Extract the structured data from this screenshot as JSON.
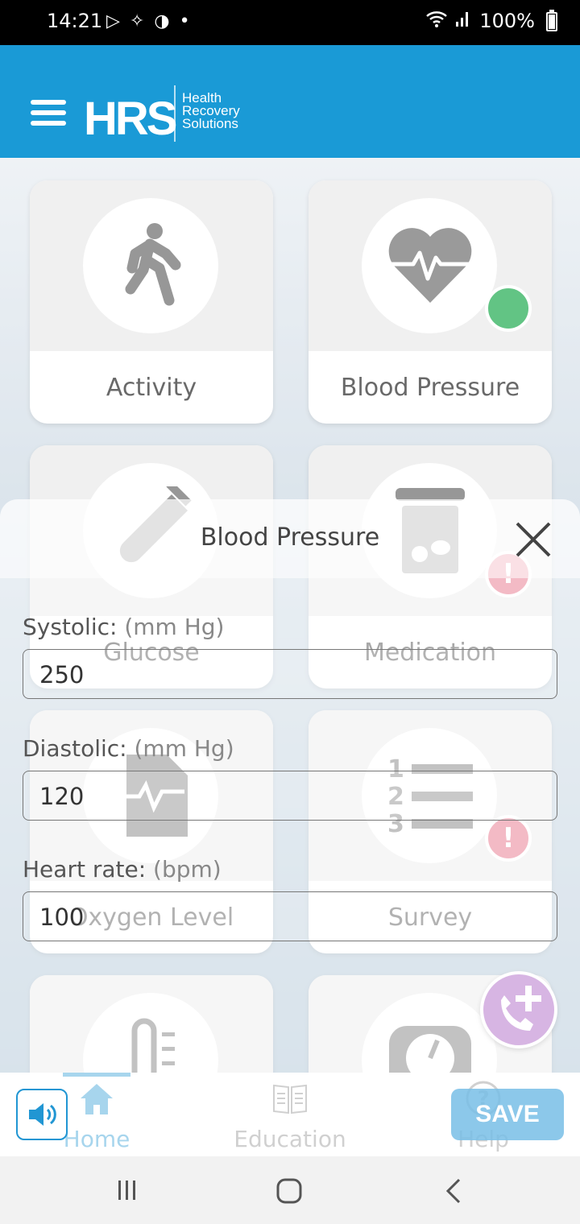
{
  "status_bar": {
    "time": "14:21",
    "battery": "100%"
  },
  "header": {
    "logo": "HRS",
    "logo_subtitle": "Health Recovery Solutions"
  },
  "tiles": [
    {
      "label": "Activity",
      "icon": "walking-person-icon"
    },
    {
      "label": "Blood Pressure",
      "icon": "heart-pulse-icon",
      "status": "complete"
    },
    {
      "label": "Glucose",
      "icon": "test-tube-icon"
    },
    {
      "label": "Medication",
      "icon": "pill-bottle-icon",
      "status": "alert"
    },
    {
      "label": "Oxygen Level",
      "icon": "pulse-document-icon"
    },
    {
      "label": "Survey",
      "icon": "numbered-list-icon",
      "status": "alert"
    },
    {
      "label": "",
      "icon": "thermometer-icon"
    },
    {
      "label": "",
      "icon": "scale-icon"
    }
  ],
  "modal": {
    "title": "Blood Pressure",
    "fields": [
      {
        "label": "Systolic:",
        "unit": "(mm Hg)",
        "value": "250"
      },
      {
        "label": "Diastolic:",
        "unit": "(mm Hg)",
        "value": "120"
      },
      {
        "label": "Heart rate:",
        "unit": "(bpm)",
        "value": "100"
      }
    ],
    "save_label": "SAVE"
  },
  "bottom_nav": {
    "home": "Home",
    "education": "Education",
    "help": "Help"
  },
  "colors": {
    "brand": "#1a9ad6",
    "complete": "#19a84a",
    "alert": "#e0506e",
    "fab": "#9a44b8"
  }
}
